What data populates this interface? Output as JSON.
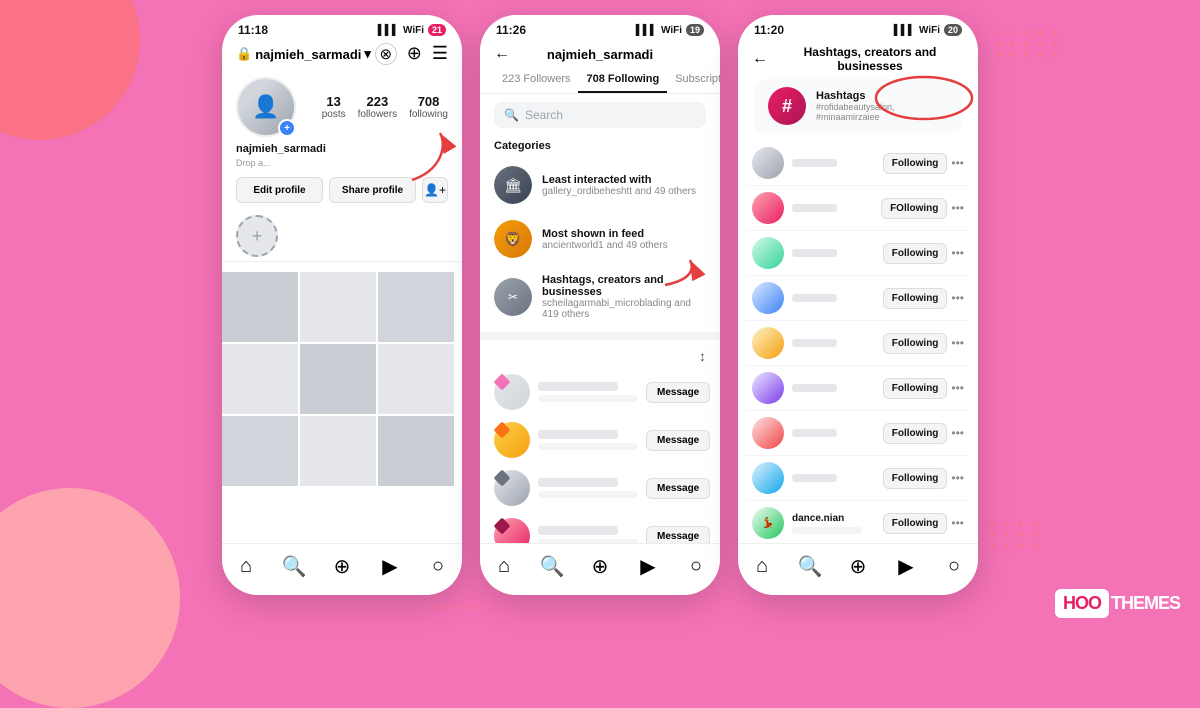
{
  "background_color": "#f472b6",
  "phone1": {
    "status_time": "11:18",
    "status_signal": "📶",
    "status_wifi": "WiFi",
    "status_battery": "21",
    "username": "najmieh_sarmadi",
    "stats": [
      {
        "num": "13",
        "label": "posts"
      },
      {
        "num": "223",
        "label": "followers"
      },
      {
        "num": "708",
        "label": "following"
      }
    ],
    "edit_profile_label": "Edit profile",
    "share_profile_label": "Share profile"
  },
  "phone2": {
    "status_time": "11:26",
    "username": "najmieh_sarmadi",
    "tabs": [
      {
        "label": "223 Followers",
        "active": false
      },
      {
        "label": "708 Following",
        "active": true
      },
      {
        "label": "Subscriptions",
        "active": false
      }
    ],
    "search_placeholder": "Search",
    "categories_label": "Categories",
    "categories": [
      {
        "title": "Least interacted with",
        "sub": "gallery_ordibeheshtt and 49 others"
      },
      {
        "title": "Most shown in feed",
        "sub": "ancientworld1 and 49 others"
      },
      {
        "title": "Hashtags, creators and businesses",
        "sub": "scheilagarmabi_microblading and 419 others"
      }
    ],
    "message_label": "Message"
  },
  "phone3": {
    "status_time": "11:20",
    "title": "Hashtags, creators and businesses",
    "hashtag_section": {
      "title": "Hashtags",
      "sub": "#rofidabeautysalon, #minaamirzaiee"
    },
    "following_rows": [
      {
        "btn": "Following"
      },
      {
        "btn": "FOllowing"
      },
      {
        "btn": "Following"
      },
      {
        "btn": "Following"
      },
      {
        "btn": "Following"
      },
      {
        "btn": "Following"
      },
      {
        "btn": "Following"
      },
      {
        "btn": "Following"
      },
      {
        "btn": "Following"
      }
    ],
    "bottom_user": "dance.nian"
  },
  "logo": {
    "hoo": "HOO",
    "themes": "THEMES"
  },
  "nav_items": [
    "⌂",
    "🔍",
    "⊕",
    "▶",
    "○"
  ]
}
